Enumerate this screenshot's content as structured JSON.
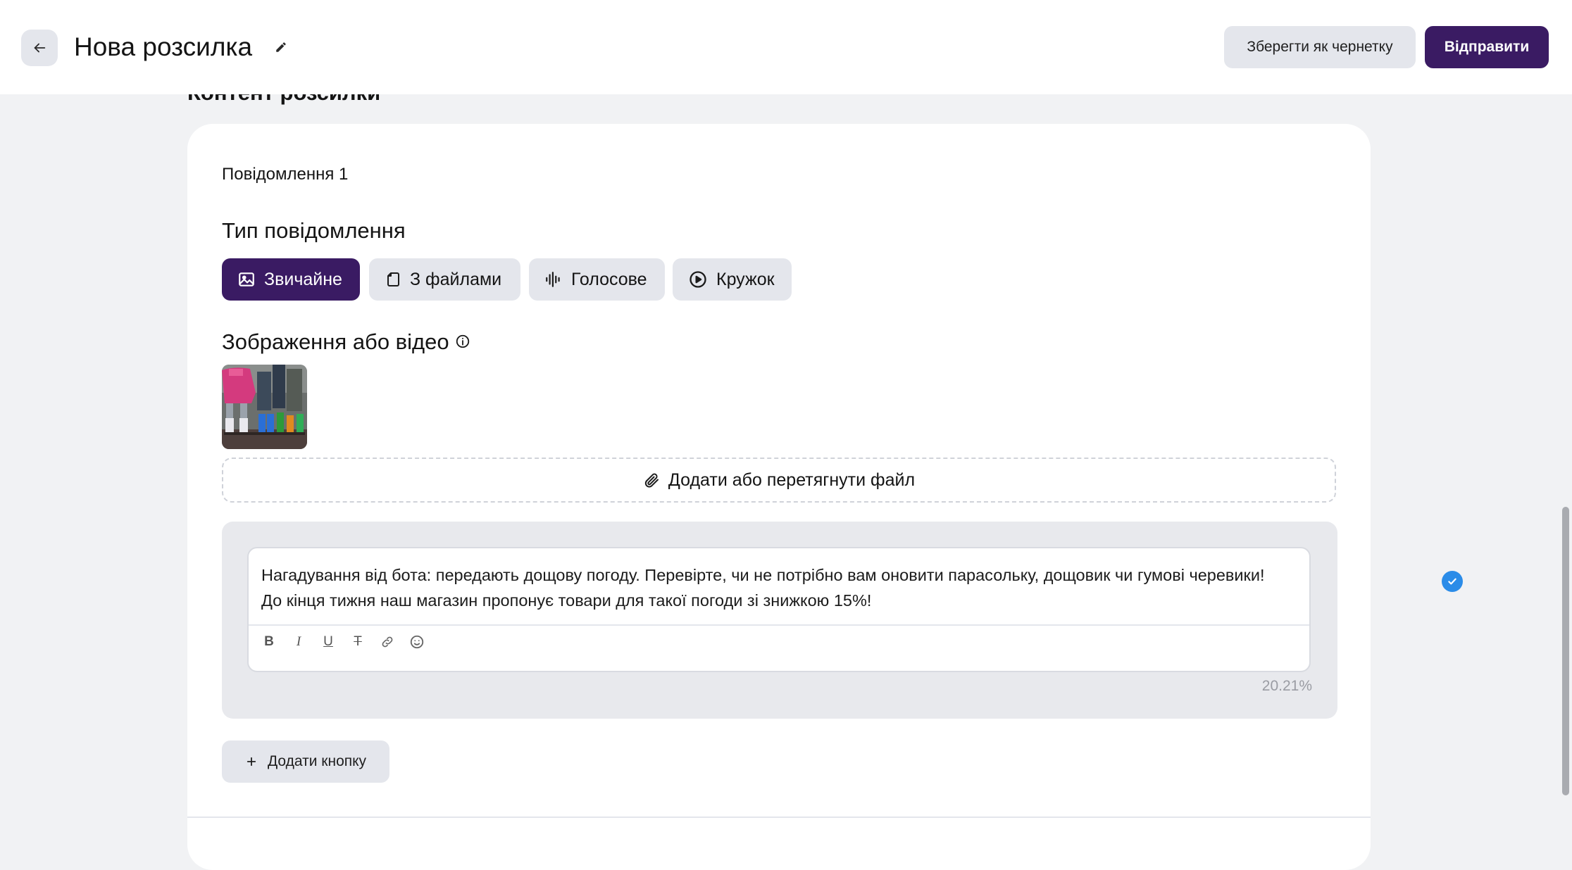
{
  "header": {
    "title": "Нова розсилка",
    "save_draft_label": "Зберегти як чернетку",
    "send_label": "Відправити"
  },
  "section": {
    "title": "Контент розсилки"
  },
  "message": {
    "label": "Повідомлення 1",
    "type_label": "Тип повідомлення",
    "types": [
      {
        "label": "Звичайне",
        "icon": "image-icon",
        "active": true
      },
      {
        "label": "З файлами",
        "icon": "file-icon",
        "active": false
      },
      {
        "label": "Голосове",
        "icon": "waveform-icon",
        "active": false
      },
      {
        "label": "Кружок",
        "icon": "play-circle-icon",
        "active": false
      }
    ],
    "media_label": "Зображення або відео",
    "dropzone_label": "Додати або перетягнути файл",
    "text_lines": [
      "Нагадування від бота: передають дощову погоду. Перевірте, чи не потрібно вам оновити парасольку, дощовик чи гумові черевики!",
      "До кінця тижня наш магазин пропонує товари для такої погоди зі знижкою 15%!"
    ],
    "toolbar": [
      {
        "label": "B",
        "name": "bold"
      },
      {
        "label": "I",
        "name": "italic"
      },
      {
        "label": "U",
        "name": "underline"
      },
      {
        "label": "T",
        "name": "strikethrough"
      },
      {
        "label": "",
        "name": "link"
      },
      {
        "label": "",
        "name": "emoji"
      }
    ],
    "char_usage": "20.21%",
    "add_button_label": "Додати кнопку"
  },
  "colors": {
    "accent": "#3a1b63",
    "secondary_button": "#e4e6ec",
    "page_background": "#f1f2f4",
    "grammar_badge": "#2b8ce8"
  }
}
